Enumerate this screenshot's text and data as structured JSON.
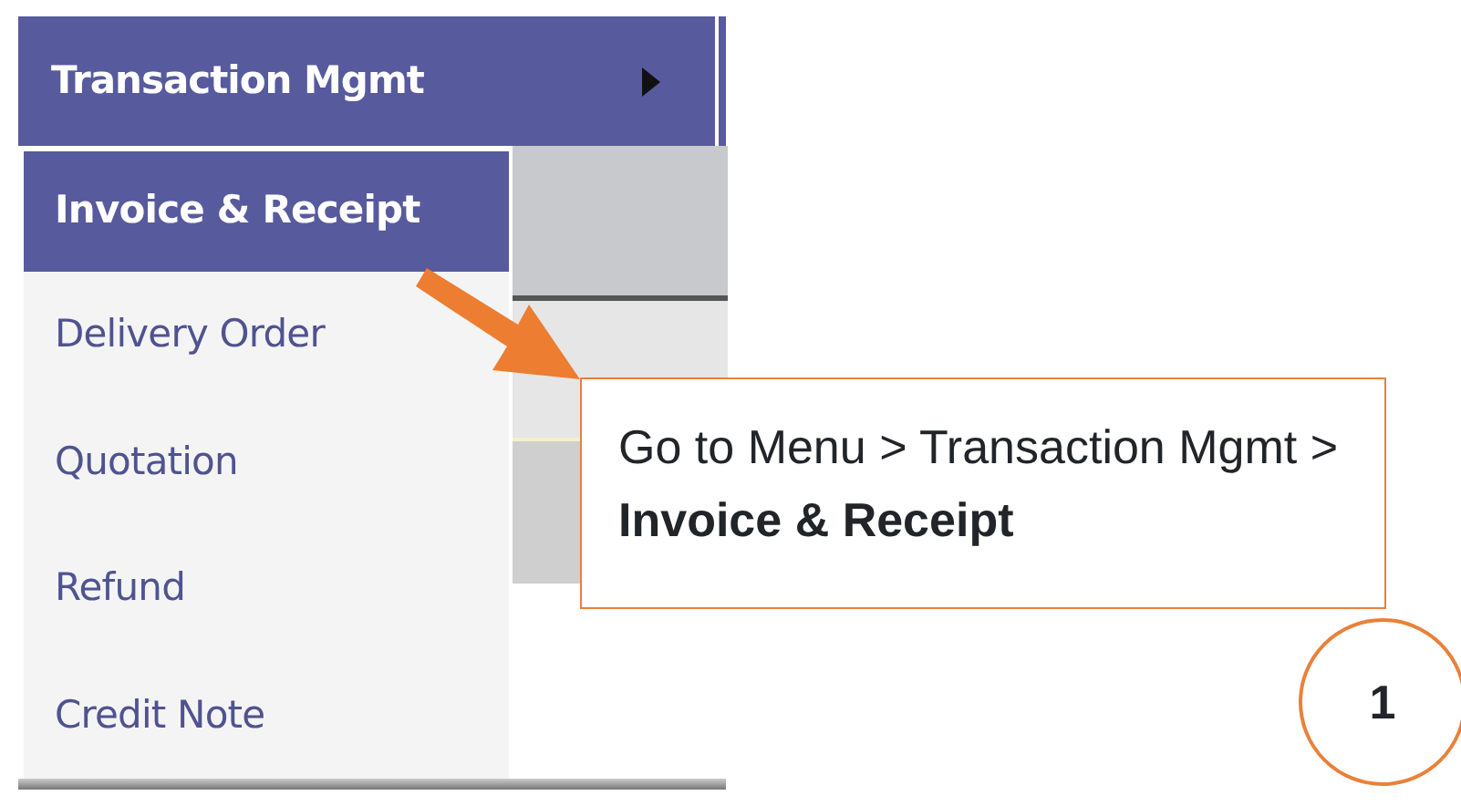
{
  "menu": {
    "title": "Transaction Mgmt",
    "expanded": true,
    "items": [
      {
        "label": "Invoice & Receipt",
        "selected": true
      },
      {
        "label": "Delivery Order",
        "selected": false
      },
      {
        "label": "Quotation",
        "selected": false
      },
      {
        "label": "Refund",
        "selected": false
      },
      {
        "label": "Credit Note",
        "selected": false
      }
    ]
  },
  "annotation": {
    "text": "Go to Menu > Transaction Mgmt > **Invoice & Receipt**",
    "step": "1"
  }
}
